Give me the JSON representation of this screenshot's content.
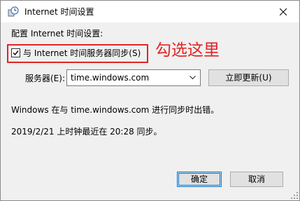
{
  "window": {
    "title": "Internet 时间设置",
    "icon": "clock-settings-icon"
  },
  "config_label": "配置 Internet 时间设置:",
  "sync": {
    "checked": true,
    "label": "与 Internet 时间服务器同步(S)"
  },
  "annotation": {
    "text": "勾选这里",
    "color": "#e02525"
  },
  "server": {
    "label": "服务器(E):",
    "value": "time.windows.com",
    "update_button": "立即更新(U)"
  },
  "status": {
    "error": "Windows 在与 time.windows.com 进行同步时出错。",
    "last_sync": "2019/2/21 上时钟最近在 20:28 同步。"
  },
  "buttons": {
    "ok": "确定",
    "cancel": "取消"
  },
  "colors": {
    "accent": "#0078d7",
    "highlight": "#e02525"
  }
}
